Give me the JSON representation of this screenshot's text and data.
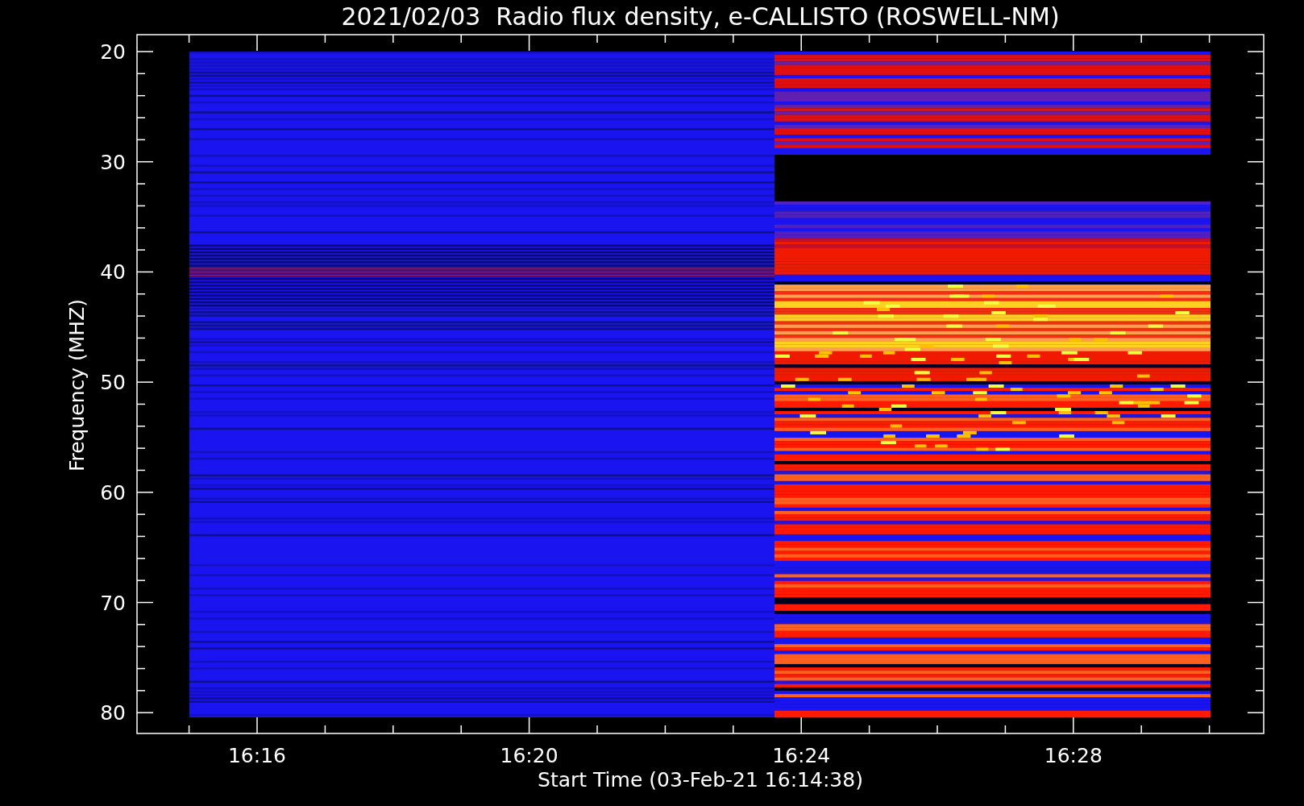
{
  "title": "2021/02/03  Radio flux density, e-CALLISTO (ROSWELL-NM)",
  "y_axis": {
    "label": "Frequency (MHZ)",
    "ticks": [
      "20",
      "30",
      "40",
      "50",
      "60",
      "70",
      "80"
    ]
  },
  "x_axis": {
    "label": "Start Time (03-Feb-21 16:14:38)",
    "ticks": [
      "16:16",
      "16:20",
      "16:24",
      "16:28"
    ]
  }
}
